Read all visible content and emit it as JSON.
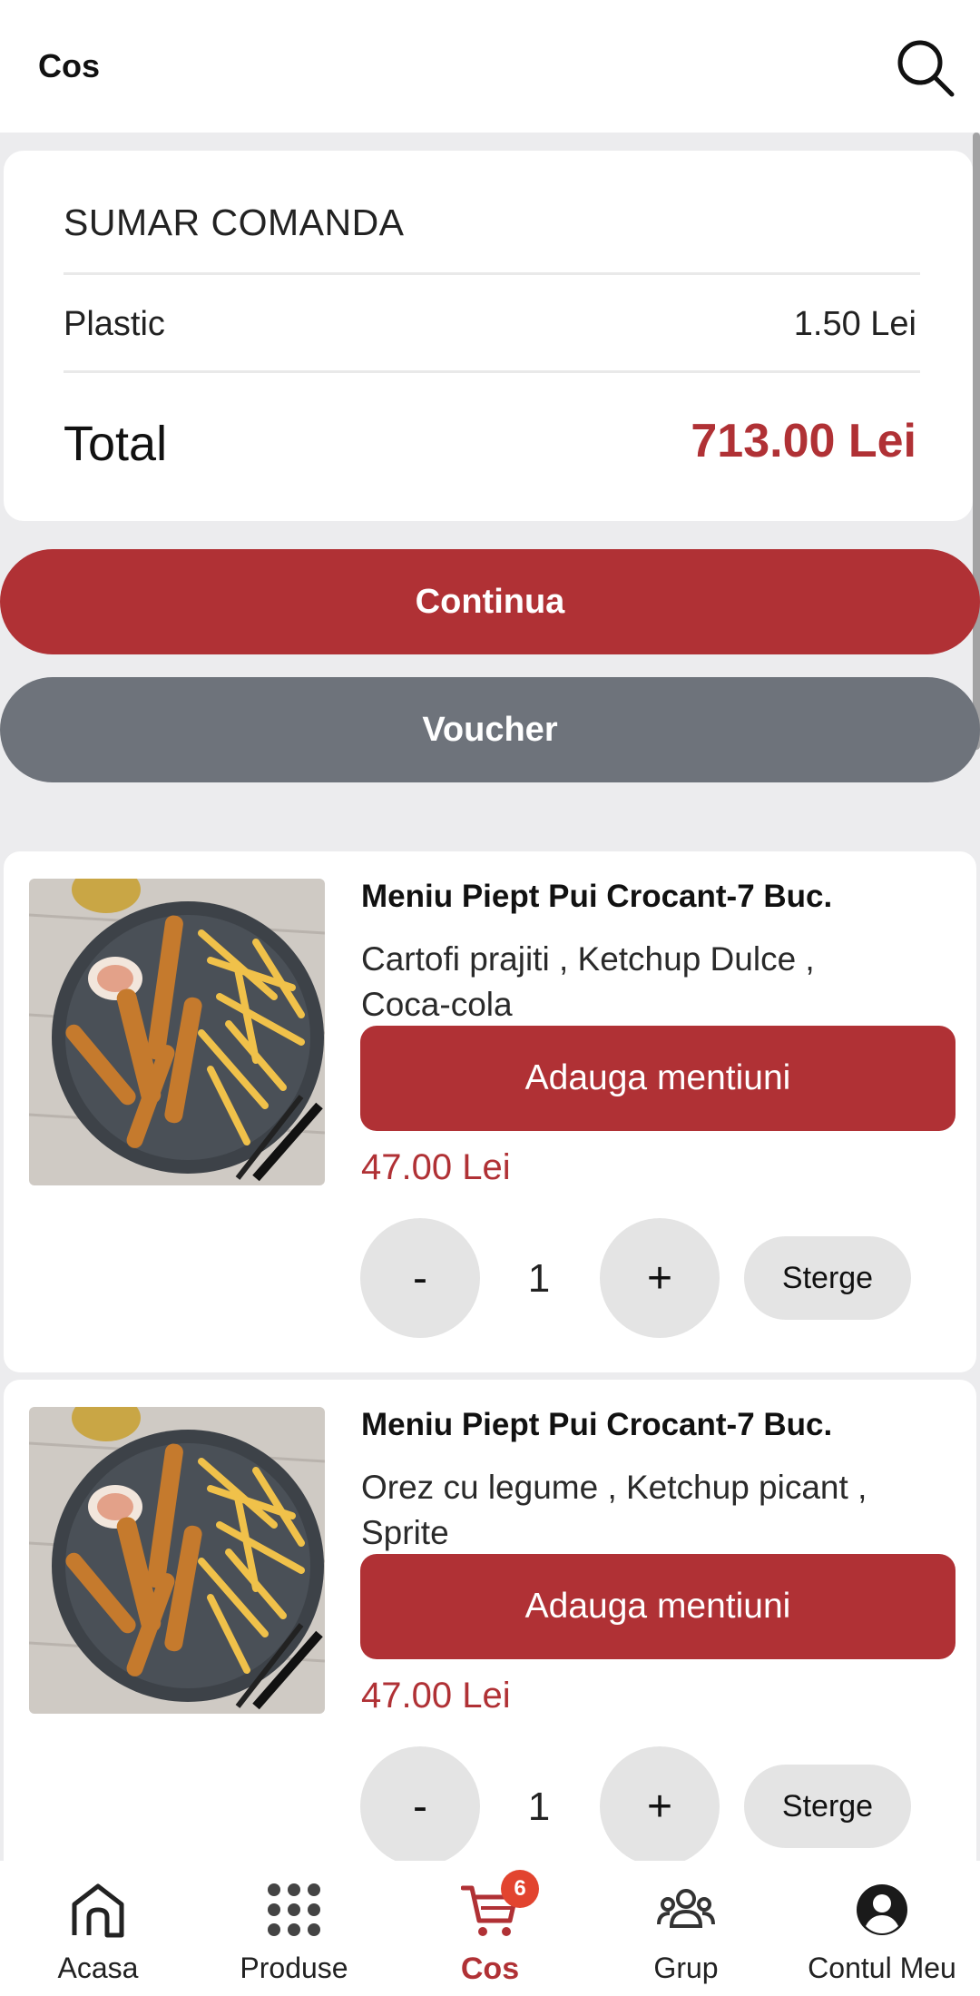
{
  "header": {
    "title": "Cos"
  },
  "summary": {
    "title": "SUMAR COMANDA",
    "rows": [
      {
        "label": "Plastic",
        "value": "1.50 Lei"
      }
    ],
    "total_label": "Total",
    "total_value": "713.00 Lei"
  },
  "actions": {
    "continue_label": "Continua",
    "voucher_label": "Voucher"
  },
  "items": [
    {
      "name": "Meniu Piept Pui Crocant-7 Buc.",
      "description": "Cartofi prajiti , Ketchup Dulce , Coca-cola",
      "mentions_label": "Adauga mentiuni",
      "price": "47.00 Lei",
      "minus": "-",
      "quantity": "1",
      "plus": "+",
      "delete_label": "Sterge"
    },
    {
      "name": "Meniu Piept Pui Crocant-7 Buc.",
      "description": "Orez cu legume , Ketchup picant , Sprite",
      "mentions_label": "Adauga mentiuni",
      "price": "47.00 Lei",
      "minus": "-",
      "quantity": "1",
      "plus": "+",
      "delete_label": "Sterge"
    }
  ],
  "nav": {
    "items": [
      {
        "label": "Acasa",
        "icon": "home-icon"
      },
      {
        "label": "Produse",
        "icon": "grid-icon"
      },
      {
        "label": "Cos",
        "icon": "cart-icon",
        "badge": "6",
        "active": true
      },
      {
        "label": "Grup",
        "icon": "group-icon"
      },
      {
        "label": "Contul Meu",
        "icon": "account-icon"
      }
    ]
  },
  "colors": {
    "accent": "#b03135",
    "secondary": "#6e737b",
    "badge": "#e2442f"
  }
}
